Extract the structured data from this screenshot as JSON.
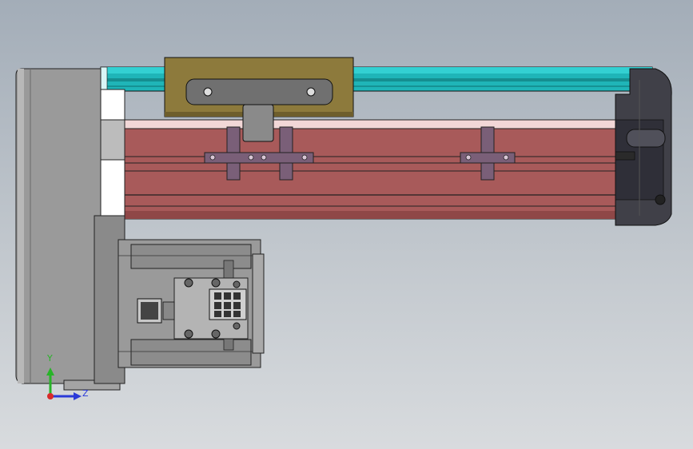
{
  "viewport": {
    "background_top": "#a3adb8",
    "background_bottom": "#d8dbde"
  },
  "model": {
    "rail_color": "#1fb5b8",
    "carriage_color": "#8d7a3c",
    "actuator_body_color": "#a85a5a",
    "actuator_top_color": "#f2d7d7",
    "end_cap_color": "#404048",
    "end_plate_color": "#9a9a9a",
    "motor_color": "#9a9a9a",
    "bracket_color": "#7a5f78"
  },
  "triad": {
    "y_label": "Y",
    "z_label": "Z",
    "y_color": "#28b428",
    "z_color": "#2a3ad8",
    "origin_color": "#d82a2a"
  }
}
